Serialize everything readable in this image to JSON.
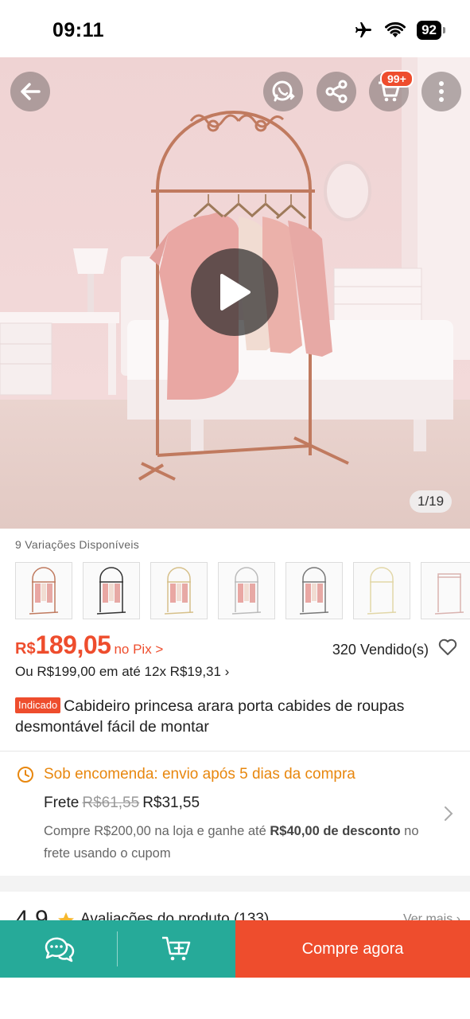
{
  "status_bar": {
    "time": "09:11",
    "battery": "92"
  },
  "hero": {
    "image_counter": "1/19",
    "cart_badge": "99+",
    "icons": [
      "back-arrow-icon",
      "whatsapp-share-icon",
      "share-icon",
      "cart-icon",
      "more-vertical-icon",
      "play-icon"
    ]
  },
  "variations": {
    "label": "9 Variações Disponíveis",
    "thumbnails": 7
  },
  "price": {
    "currency": "R$",
    "value": "189,05",
    "pix_label": "no Pix >",
    "installments": "Ou R$199,00 em até 12x R$19,31 ›",
    "sold": "320 Vendido(s)"
  },
  "product": {
    "tag": "Indicado",
    "title": "Cabideiro princesa arara porta cabides de roupas desmontável fácil de montar"
  },
  "shipping": {
    "headline": "Sob encomenda: envio após 5 dias da compra",
    "frete_label": "Frete",
    "old_price": "R$61,55",
    "new_price": "R$31,55",
    "promo_part1": "Compre R$200,00 na loja e ganhe até",
    "promo_bold1": "R$40,00 de desconto",
    "promo_part2": "no frete usando o cupom"
  },
  "reviews": {
    "rating": "4.9",
    "label": "Avaliações do produto (133)",
    "see_more": "Ver mais ›"
  },
  "bottom_bar": {
    "buy_label": "Compre agora"
  },
  "colors": {
    "accent": "#ee4d2d",
    "teal": "#26aa99",
    "shipping_orange": "#e8870e"
  }
}
